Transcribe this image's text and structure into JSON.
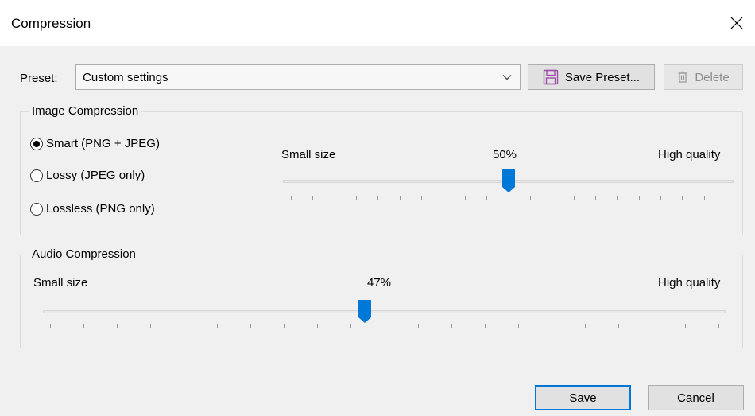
{
  "window": {
    "title": "Compression"
  },
  "preset": {
    "label": "Preset:",
    "selected": "Custom settings",
    "save_preset_label": "Save Preset...",
    "delete_label": "Delete"
  },
  "image_compression": {
    "title": "Image Compression",
    "options": [
      {
        "label": "Smart (PNG + JPEG)",
        "checked": true
      },
      {
        "label": "Lossy (JPEG only)",
        "checked": false
      },
      {
        "label": "Lossless (PNG only)",
        "checked": false
      }
    ],
    "slider": {
      "min_label": "Small size",
      "max_label": "High quality",
      "value_text": "50%",
      "value": 50
    }
  },
  "audio_compression": {
    "title": "Audio Compression",
    "slider": {
      "min_label": "Small size",
      "max_label": "High quality",
      "value_text": "47%",
      "value": 47
    }
  },
  "footer": {
    "save_label": "Save",
    "cancel_label": "Cancel"
  },
  "colors": {
    "accent": "#0078d7",
    "floppy_icon": "#9b4fa8"
  },
  "icons": {
    "close": "close-icon",
    "chevron": "chevron-down-icon",
    "save_preset": "floppy-disk-icon",
    "delete": "trash-icon"
  }
}
